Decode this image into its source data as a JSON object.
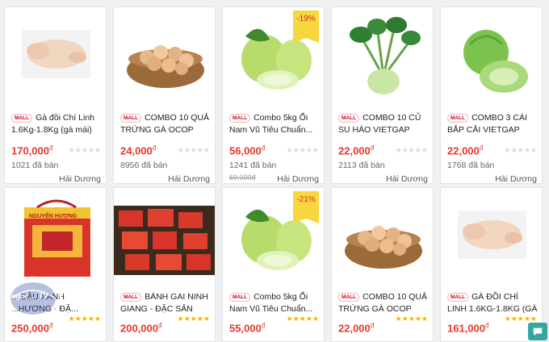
{
  "products_row1": [
    {
      "title": "Gà đồi Chí Linh 1.6Kg-1.8Kg (gà mái) ti...",
      "price": "170,000",
      "sold": "1021 đã bán",
      "location": "Hải Dương",
      "old_price": "",
      "discount": "",
      "image": "raw-chicken",
      "stars": "★★★★★"
    },
    {
      "title": "COMBO 10 QUẢ TRỨNG GÀ OCOP CẨM...",
      "price": "24,000",
      "sold": "8956 đã bán",
      "location": "Hải Dương",
      "old_price": "",
      "discount": "",
      "image": "egg-basket",
      "stars": "★★★★★"
    },
    {
      "title": "Combo 5kg Ổi Nam Vũ Tiêu Chuẩn...",
      "price": "56,000",
      "sold": "1241 đã bán",
      "location": "Hải Dương",
      "old_price": "69,000",
      "discount": "-19%",
      "image": "guava",
      "stars": "★★★★★"
    },
    {
      "title": "COMBO 10 CỦ SU HÀO VIETGAP HẢI...",
      "price": "22,000",
      "sold": "2113 đã bán",
      "location": "Hải Dương",
      "old_price": "",
      "discount": "",
      "image": "kohlrabi",
      "stars": "★★★★★"
    },
    {
      "title": "COMBO 3 CÁI BẮP CẢI VIETGAP HẢI...",
      "price": "22,000",
      "sold": "1768 đã bán",
      "location": "Hải Dương",
      "old_price": "",
      "discount": "",
      "image": "cabbage",
      "stars": "★★★★★"
    }
  ],
  "products_row2": [
    {
      "title": "... ĐẬU XANH ...HƯƠNG - ĐẶ...",
      "price": "250,000",
      "discount": "",
      "image": "mung-bean-cake-box",
      "stars": "★★★★★"
    },
    {
      "title": "BÁNH GAI NINH GIANG - ĐẶC SẢN HẢI...",
      "price": "200,000",
      "discount": "",
      "image": "banh-gai",
      "stars": "★★★★★"
    },
    {
      "title": "Combo 5kg Ổi Nam Vũ Tiêu Chuẩn...",
      "price": "55,000",
      "discount": "-21%",
      "image": "guava",
      "stars": "★★★★★"
    },
    {
      "title": "COMBO 10 QUẢ TRỨNG GÀ OCOP CẨM...",
      "price": "22,000",
      "discount": "",
      "image": "egg-basket",
      "stars": "★★★★★"
    },
    {
      "title": "GÀ ĐỒI CHÍ LINH 1.6KG-1.8KG (GÀ MÁI)...",
      "price": "161,000",
      "discount": "",
      "image": "raw-chicken",
      "stars": "★★★★★"
    }
  ],
  "mall_badge": "MALL",
  "currency": "đ",
  "package_brand": "NGUYÊN HƯƠNG",
  "overlay_logo": "ngoc ... TV",
  "chat_icon": "chat-icon",
  "colors": {
    "price": "#e4392b",
    "mall": "#d0011b",
    "discount_bg": "#f7d73e",
    "star": "#f5b301",
    "chat": "#35a7a0"
  }
}
